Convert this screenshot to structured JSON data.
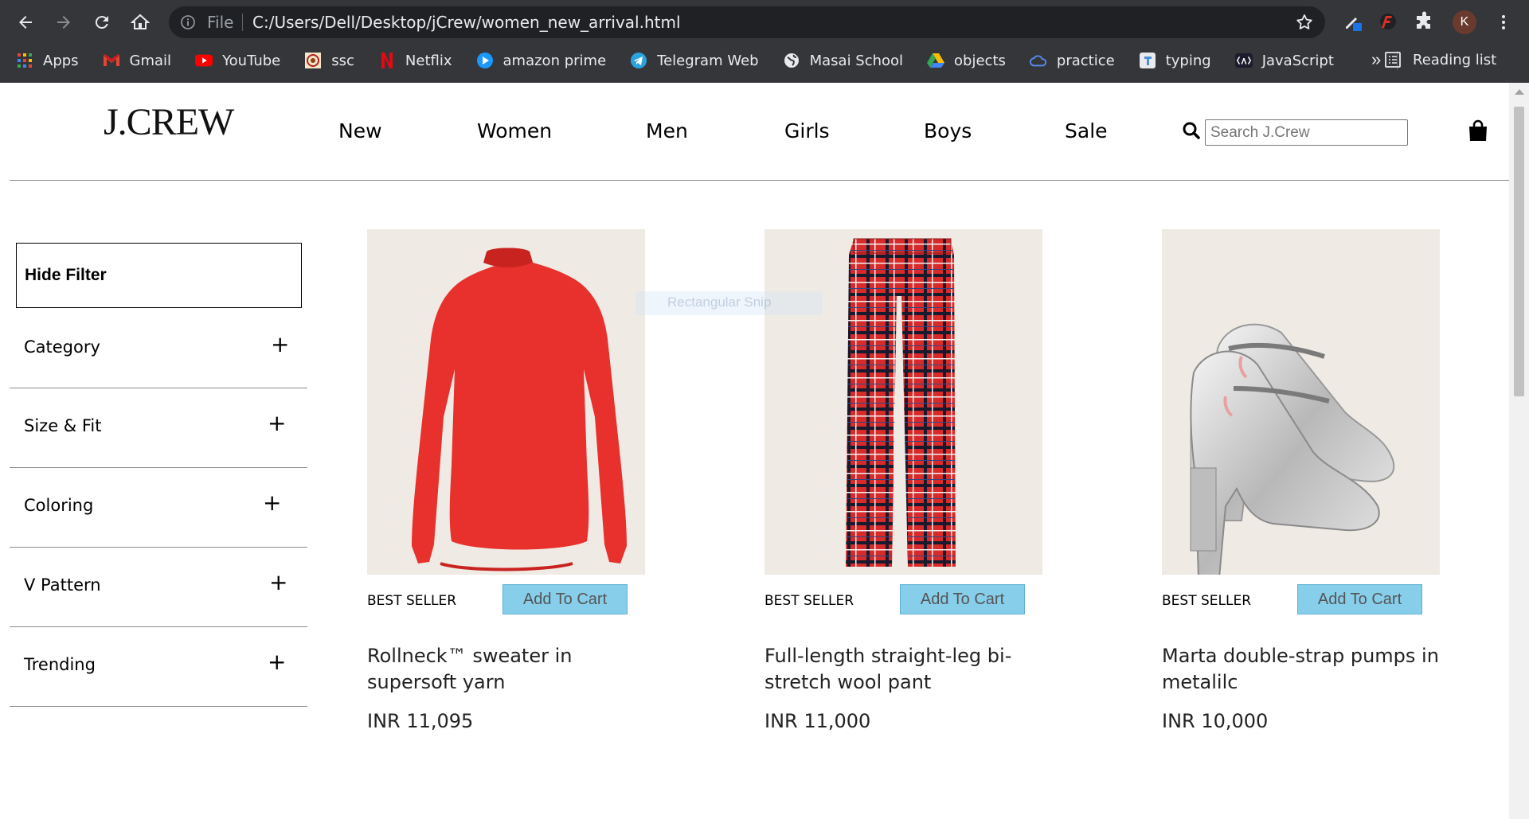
{
  "browser": {
    "url_scheme": "File",
    "url": "C:/Users/Dell/Desktop/jCrew/women_new_arrival.html",
    "profile_initial": "K",
    "bookmarks": [
      {
        "label": "Apps",
        "icon": "apps-grid-icon"
      },
      {
        "label": "Gmail",
        "icon": "gmail-icon"
      },
      {
        "label": "YouTube",
        "icon": "youtube-icon"
      },
      {
        "label": "ssc",
        "icon": "ssc-emblem-icon"
      },
      {
        "label": "Netflix",
        "icon": "netflix-icon"
      },
      {
        "label": "amazon prime",
        "icon": "prime-video-icon"
      },
      {
        "label": "Telegram Web",
        "icon": "telegram-icon"
      },
      {
        "label": "Masai School",
        "icon": "globe-icon"
      },
      {
        "label": "objects",
        "icon": "google-drive-icon"
      },
      {
        "label": "practice",
        "icon": "cloud-icon"
      },
      {
        "label": "typing",
        "icon": "typing-t-icon"
      },
      {
        "label": "JavaScript",
        "icon": "lambda-icon"
      }
    ],
    "more_label": "»",
    "reading_list": "Reading list"
  },
  "site": {
    "logo": "J.CREW",
    "nav": [
      "New",
      "Women",
      "Men",
      "Girls",
      "Boys",
      "Sale"
    ],
    "search_placeholder": "Search J.Crew"
  },
  "filters": {
    "hide_label": "Hide Filter",
    "items": [
      "Category",
      "Size & Fit",
      "Coloring",
      "V Pattern",
      "Trending"
    ],
    "plus": "+"
  },
  "products": [
    {
      "badge": "BEST SELLER",
      "cart_label": "Add To Cart",
      "name": "Rollneck™ sweater in supersoft yarn",
      "price": "INR 11,095"
    },
    {
      "badge": "BEST SELLER",
      "cart_label": "Add To Cart",
      "name": "Full-length straight-leg bi-stretch wool pant",
      "price": "INR 11,000"
    },
    {
      "badge": "BEST SELLER",
      "cart_label": "Add To Cart",
      "name": "Marta double-strap pumps in metalilc",
      "price": "INR 10,000"
    }
  ],
  "overlay": {
    "ghost_text": "Rectangular Snip"
  },
  "colors": {
    "chrome": "#35363a",
    "omnibox": "#202124",
    "cart_button": "#87ceeb",
    "product_bg": "#efebe4",
    "sweater": "#e8302c"
  }
}
